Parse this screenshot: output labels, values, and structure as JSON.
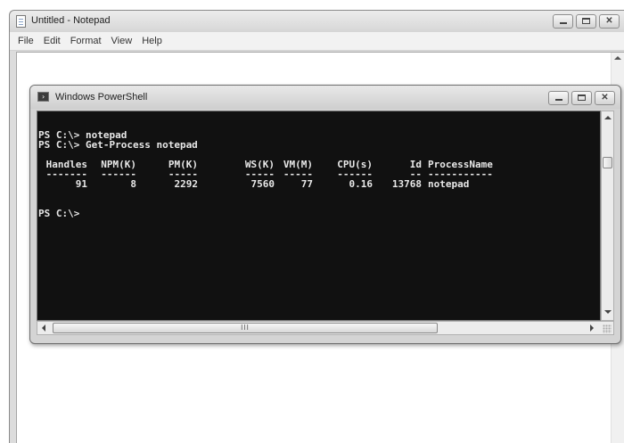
{
  "notepad": {
    "title": "Untitled - Notepad",
    "menu": [
      "File",
      "Edit",
      "Format",
      "View",
      "Help"
    ],
    "caption_close": "✕"
  },
  "powershell": {
    "title": "Windows PowerShell",
    "caption_close": "✕",
    "lines": {
      "cmd1": "PS C:\\> notepad",
      "cmd2": "PS C:\\> Get-Process notepad",
      "prompt": "PS C:\\>"
    },
    "table": {
      "headers": [
        "Handles",
        "NPM(K)",
        "PM(K)",
        "WS(K)",
        "VM(M)",
        "CPU(s)",
        "Id",
        "ProcessName"
      ],
      "dashes": [
        "-------",
        "------",
        "-----",
        "-----",
        "-----",
        "------",
        "--",
        "-----------"
      ],
      "row": [
        "91",
        "8",
        "2292",
        "7560",
        "77",
        "0.16",
        "13768",
        "notepad"
      ]
    },
    "hscroll_thumb_label": "III"
  }
}
